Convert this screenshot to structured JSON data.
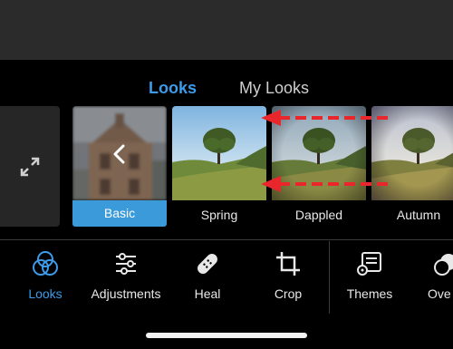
{
  "tabs": {
    "looks": "Looks",
    "my_looks": "My Looks"
  },
  "looks": [
    {
      "label": "Basic",
      "selected": true
    },
    {
      "label": "Spring"
    },
    {
      "label": "Dappled"
    },
    {
      "label": "Autumn"
    }
  ],
  "nav": {
    "looks": "Looks",
    "adjustments": "Adjustments",
    "heal": "Heal",
    "crop": "Crop",
    "themes": "Themes",
    "overlays": "Ove"
  },
  "colors": {
    "accent": "#3d9be9",
    "selected_label_bg": "#3b9ad9",
    "annotation_arrow": "#e8262c"
  },
  "icons": {
    "expand": "expand-icon",
    "back": "chevron-left-icon",
    "looks": "looks-icon",
    "adjustments": "sliders-icon",
    "heal": "bandage-icon",
    "crop": "crop-icon",
    "themes": "themes-icon",
    "overlays": "overlays-icon"
  }
}
